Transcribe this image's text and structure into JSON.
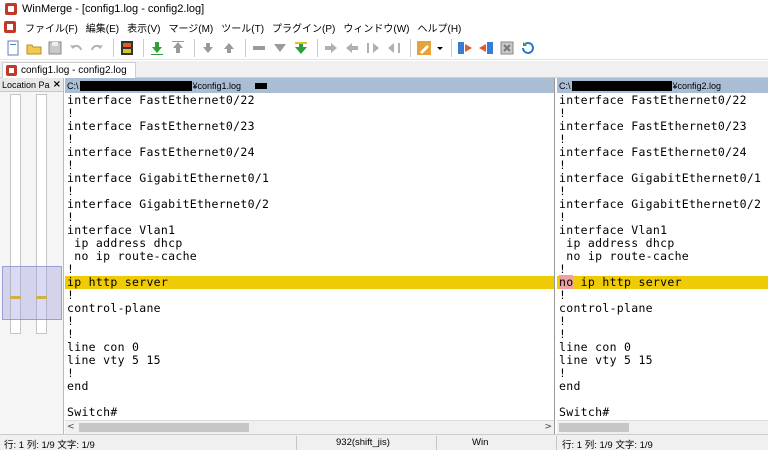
{
  "window": {
    "title": "WinMerge - [config1.log - config2.log]"
  },
  "menu": [
    "ファイル(F)",
    "編集(E)",
    "表示(V)",
    "マージ(M)",
    "ツール(T)",
    "プラグイン(P)",
    "ウィンドウ(W)",
    "ヘルプ(H)"
  ],
  "toolbar_icons": [
    "new-document-icon",
    "open-folder-icon",
    "save-icon",
    "undo-icon",
    "redo-icon",
    "filmstrip-icon",
    "next-diff-icon",
    "prev-diff-icon",
    "first-diff-icon",
    "last-diff-icon",
    "current-diff-icon",
    "copy-all-right-icon",
    "copy-right-icon",
    "copy-left-icon",
    "copy-right-advance-icon",
    "copy-left-advance-icon",
    "options-icon",
    "dropdown-arrow-icon",
    "compare-icon",
    "merge-icon",
    "stop-icon",
    "refresh-icon"
  ],
  "tab": {
    "label": "config1.log - config2.log"
  },
  "location_pane": {
    "title": "Location Pa",
    "close": "×"
  },
  "left_pane": {
    "header_prefix": "C:\\",
    "header_file": "¥config1.log",
    "lines": [
      "interface FastEthernet0/22",
      "!",
      "interface FastEthernet0/23",
      "!",
      "interface FastEthernet0/24",
      "!",
      "interface GigabitEthernet0/1",
      "!",
      "interface GigabitEthernet0/2",
      "!",
      "interface Vlan1",
      " ip address dhcp",
      " no ip route-cache",
      "!",
      "ip http server",
      "!",
      "control-plane",
      "!",
      "!",
      "line con 0",
      "line vty 5 15",
      "!",
      "end",
      "",
      "Switch#"
    ]
  },
  "right_pane": {
    "header_prefix": "C:\\",
    "header_file": "¥config2.log",
    "lines": [
      "interface FastEthernet0/22",
      "!",
      "interface FastEthernet0/23",
      "!",
      "interface FastEthernet0/24",
      "!",
      "interface GigabitEthernet0/1",
      "!",
      "interface GigabitEthernet0/2",
      "!",
      "interface Vlan1",
      " ip address dhcp",
      " no ip route-cache",
      "!",
      "no ip http server",
      "!",
      "control-plane",
      "!",
      "!",
      "line con 0",
      "line vty 5 15",
      "!",
      "end",
      "",
      "Switch#"
    ]
  },
  "diff_line_index": 14,
  "diff_highlight_right": "no",
  "status": {
    "left_pos": "行: 1  列: 1/9  文字: 1/9",
    "encoding": "932(shift_jis)",
    "eol": "Win",
    "right_pos": "行: 1  列: 1/9  文字: 1/9"
  },
  "colors": {
    "diff": "#efcb05",
    "word_diff": "#f0a0a0",
    "pane_header": "#a9bdd5"
  }
}
